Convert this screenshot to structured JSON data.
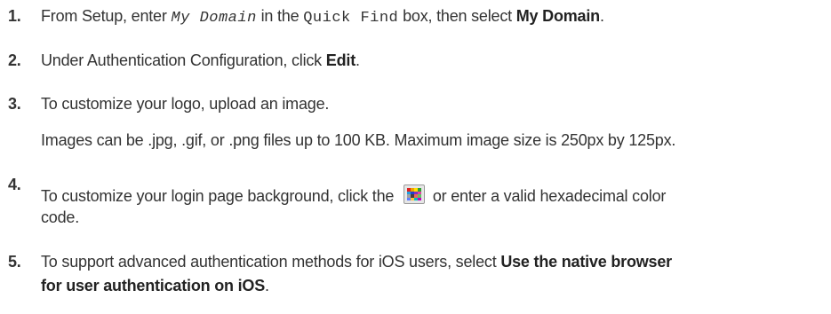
{
  "steps": [
    {
      "number": "1.",
      "part1": "From Setup, enter ",
      "code1": "My Domain",
      "part2": " in the ",
      "code2": "Quick Find",
      "part3": " box, then select ",
      "bold": "My Domain",
      "end": "."
    },
    {
      "number": "2.",
      "part1": "Under Authentication Configuration, click ",
      "bold": "Edit",
      "end": "."
    },
    {
      "number": "3.",
      "line1": "To customize your logo, upload an image.",
      "line2": "Images can be .jpg, .gif, or .png files up to 100 KB. Maximum image size is 250px by 125px."
    },
    {
      "number": "4.",
      "part1": "To customize your login page background, click the ",
      "icon": "color-picker-icon",
      "part2": " or enter a valid hexadecimal color",
      "line2": "code."
    },
    {
      "number": "5.",
      "part1": "To support advanced authentication methods for iOS users, select ",
      "bold1": "Use the native browser",
      "bold2": "for user authentication on iOS",
      "end": "."
    }
  ],
  "colors": {
    "text": "#333333",
    "picker_swatches": [
      "#e02020",
      "#f0a000",
      "#ffe000",
      "#30a030",
      "#20a0e0",
      "#2040d0",
      "#8030c0",
      "#e040a0",
      "#a0a0a0",
      "#404040",
      "#f06060",
      "#60c060",
      "#6080ff",
      "#ffc040",
      "#00c0c0",
      "#c000c0"
    ]
  }
}
